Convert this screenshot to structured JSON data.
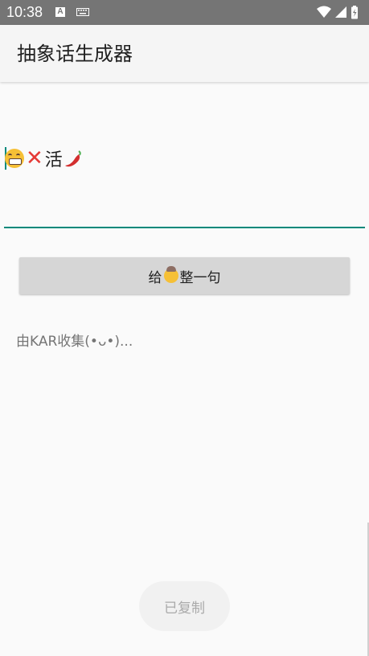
{
  "status_bar": {
    "time": "10:38",
    "notif_a": "A",
    "bg_color": "#757575",
    "icons": [
      "wifi-icon",
      "signal-icon",
      "battery-icon"
    ]
  },
  "app_bar": {
    "title": "抽象话生成器"
  },
  "result": {
    "emoji_1": "grinning-face-icon",
    "emoji_2": "cross-mark-icon",
    "text_char": "活",
    "emoji_3": "hot-pepper-icon"
  },
  "button": {
    "label_before": "给",
    "emoji": "old-man-icon",
    "label_after": "整一句"
  },
  "credit": "由KAR收集(•ᴗ•)...",
  "toast": "已复制",
  "colors": {
    "accent": "#00897b",
    "button_bg": "#d6d6d6"
  }
}
